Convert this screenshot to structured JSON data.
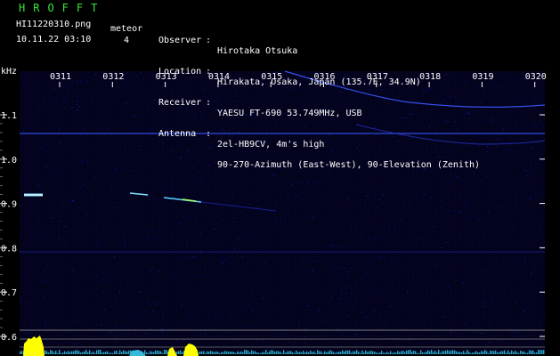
{
  "header": {
    "app_title": "HROFFT",
    "filename": "HI11220310.png",
    "datetime": "10.11.22 03:10",
    "meteor_label": "meteor",
    "meteor_count": "4",
    "info": [
      {
        "key": "Observer",
        "value": "Hirotaka Otsuka"
      },
      {
        "key": "Location",
        "value": "Hirakata, Osaka, Japan (135.7E, 34.9N)"
      },
      {
        "key": "Receiver",
        "value": "YAESU FT-690 53.749MHz, USB"
      },
      {
        "key": "Antenna",
        "value": "2el-HB9CV, 4m's high"
      }
    ],
    "antenna_line2": "90-270-Azimuth (East-West), 90-Elevation (Zenith)"
  },
  "chart_data": {
    "type": "heatmap",
    "ylabel": "kHz",
    "y_ticks": [
      "1.1",
      "1.0",
      "0.9",
      "0.8",
      "0.7",
      "0.6"
    ],
    "y_tick_values": [
      1.1,
      1.0,
      0.9,
      0.8,
      0.7,
      0.6
    ],
    "x_ticks": [
      "0311",
      "0312",
      "0313",
      "0314",
      "0315",
      "0316",
      "0317",
      "0318",
      "0319",
      "0320"
    ],
    "ylim": [
      0.58,
      1.2
    ],
    "colors": {
      "background": "#000000",
      "noise": "#0a0a6e",
      "grid": "#1c1c5a",
      "carrier": "#3a58ff",
      "meteor": "#7fe0ff",
      "level": "#ffff00",
      "level_baseline": "#2aa8c8"
    },
    "meteor_echoes": [
      {
        "minute": "0310",
        "freq_khz": 0.92
      },
      {
        "minute": "0312.5",
        "freq_khz": 0.925
      },
      {
        "minute": "0313.2",
        "freq_khz": 0.915
      }
    ]
  }
}
